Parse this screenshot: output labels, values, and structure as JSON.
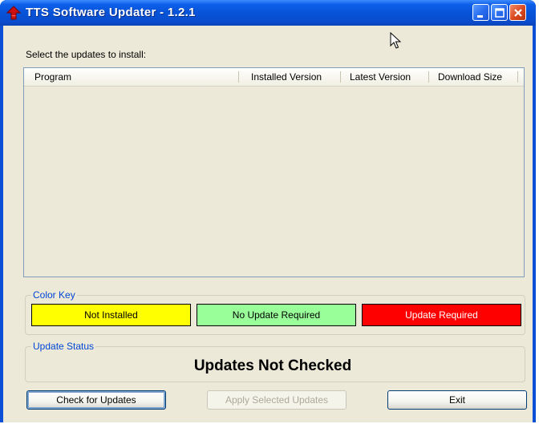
{
  "window": {
    "title": "TTS Software Updater - 1.2.1"
  },
  "main": {
    "instruction": "Select the updates to install:",
    "list": {
      "columns": [
        "Program",
        "Installed Version",
        "Latest Version",
        "Download Size"
      ],
      "rows": []
    }
  },
  "color_key": {
    "title": "Color Key",
    "items": [
      {
        "label": "Not Installed",
        "color": "#ffff00"
      },
      {
        "label": "No Update Required",
        "color": "#99ff99"
      },
      {
        "label": "Update Required",
        "color": "#ff0000"
      }
    ]
  },
  "update_status": {
    "title": "Update Status",
    "text": "Updates Not Checked"
  },
  "buttons": {
    "check": "Check for Updates",
    "apply": "Apply Selected Updates",
    "exit": "Exit"
  },
  "colors": {
    "titlebar": "#0752d6",
    "client_bg": "#ece9d8",
    "group_title": "#0046d5"
  }
}
